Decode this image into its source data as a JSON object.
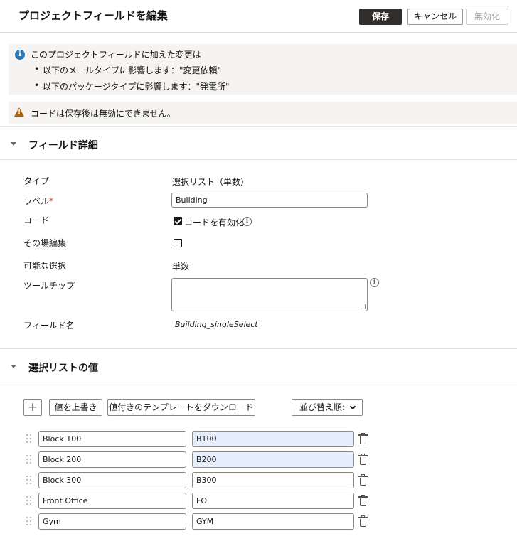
{
  "header": {
    "title": "プロジェクトフィールドを編集",
    "save_label": "保存",
    "cancel_label": "キャンセル",
    "disable_label": "無効化"
  },
  "info": {
    "heading": "このプロジェクトフィールドに加えた変更は",
    "bullets": [
      "以下のメールタイプに影響します：\"変更依頼\"",
      "以下のパッケージタイプに影響します：\"発電所\""
    ]
  },
  "warning": {
    "text": "コードは保存後は無効にできません。"
  },
  "field_details": {
    "section_title": "フィールド詳細",
    "type_label": "タイプ",
    "type_value": "選択リスト（単数）",
    "label_label": "ラベル",
    "label_required": "*",
    "label_value": "Building",
    "code_label": "コード",
    "code_checkbox_label": "コードを有効化",
    "code_enabled": true,
    "inline_edit_label": "その場編集",
    "inline_edit_enabled": false,
    "possible_selection_label": "可能な選択",
    "possible_selection_value": "単数",
    "tooltip_label": "ツールチップ",
    "tooltip_value": "",
    "field_name_label": "フィールド名",
    "field_name_value": "Building_singleSelect"
  },
  "select_values": {
    "section_title": "選択リストの値",
    "add_label": "+",
    "overwrite_label": "値を上書き",
    "download_label": "値付きのテンプレートをダウンロード",
    "sort_label": "並び替え順:",
    "rows": [
      {
        "name": "Block 100",
        "code": "B100",
        "highlight": true
      },
      {
        "name": "Block 200",
        "code": "B200",
        "highlight": true
      },
      {
        "name": "Block 300",
        "code": "B300",
        "highlight": false
      },
      {
        "name": "Front Office",
        "code": "FO",
        "highlight": false
      },
      {
        "name": "Gym",
        "code": "GYM",
        "highlight": false
      }
    ]
  },
  "icons": {
    "info": "info-icon",
    "warning": "warning-icon",
    "help": "help-icon",
    "drag": "drag-handle-icon",
    "trash": "trash-icon",
    "collapse": "caret-down-icon"
  },
  "colors": {
    "primary_button": "#312d2a",
    "info_icon": "#2a78b5",
    "warning_icon": "#ac630c",
    "required": "#d63b25",
    "highlight_input": "#e6edfb"
  }
}
